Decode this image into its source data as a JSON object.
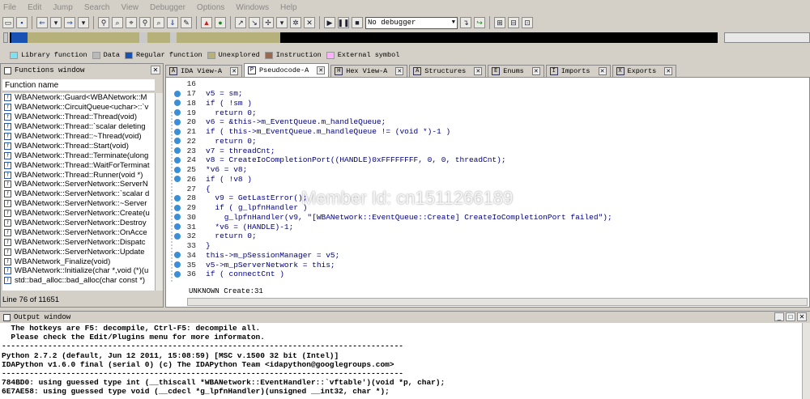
{
  "menu": [
    "File",
    "Edit",
    "Jump",
    "Search",
    "View",
    "Debugger",
    "Options",
    "Windows",
    "Help"
  ],
  "toolbar": {
    "debugger_select": "No debugger"
  },
  "legend": [
    {
      "label": "Library function",
      "color": "#7fe0ef"
    },
    {
      "label": "Data",
      "color": "#b9b9b9"
    },
    {
      "label": "Regular function",
      "color": "#1a52b4"
    },
    {
      "label": "Unexplored",
      "color": "#b6b07a"
    },
    {
      "label": "Instruction",
      "color": "#9a6a50"
    },
    {
      "label": "External symbol",
      "color": "#ffb0ff"
    }
  ],
  "functions_window": {
    "title": "Functions window",
    "column_header": "Function name",
    "status": "Line 76 of 11651",
    "items": [
      "WBANetwork::Guard<WBANetwork::M",
      "WBANetwork::CircuitQueue<uchar>::`v",
      "WBANetwork::Thread::Thread(void)",
      "WBANetwork::Thread::`scalar deleting",
      "WBANetwork::Thread::~Thread(void)",
      "WBANetwork::Thread::Start(void)",
      "WBANetwork::Thread::Terminate(ulong",
      "WBANetwork::Thread::WaitForTerminat",
      "WBANetwork::Thread::Runner(void *)",
      "WBANetwork::ServerNetwork::ServerN",
      "WBANetwork::ServerNetwork::`scalar d",
      "WBANetwork::ServerNetwork::~Server",
      "WBANetwork::ServerNetwork::Create(u",
      "WBANetwork::ServerNetwork::Destroy",
      "WBANetwork::ServerNetwork::OnAcce",
      "WBANetwork::ServerNetwork::Dispatc",
      "WBANetwork::ServerNetwork::Update",
      "WBANetwork_Finalize(void)",
      "WBANetwork::Initialize(char *,void (*)(u",
      "std::bad_alloc::bad_alloc(char const *)"
    ]
  },
  "tabs": [
    {
      "label": "IDA View-A",
      "icon": "A",
      "active": false
    },
    {
      "label": "Pseudocode-A",
      "icon": "P",
      "active": true
    },
    {
      "label": "Hex View-A",
      "icon": "H",
      "active": false
    },
    {
      "label": "Structures",
      "icon": "A",
      "active": false
    },
    {
      "label": "Enums",
      "icon": "E",
      "active": false
    },
    {
      "label": "Imports",
      "icon": "I",
      "active": false
    },
    {
      "label": "Exports",
      "icon": "X",
      "active": false
    }
  ],
  "code": {
    "lines": [
      {
        "n": "16",
        "dot": false,
        "text": ""
      },
      {
        "n": "17",
        "dot": true,
        "text": "v5 = sm;"
      },
      {
        "n": "18",
        "dot": true,
        "text": "if ( !sm )"
      },
      {
        "n": "19",
        "dot": true,
        "text": "  return 0;"
      },
      {
        "n": "20",
        "dot": true,
        "text": "v6 = &this->m_EventQueue.m_handleQueue;"
      },
      {
        "n": "21",
        "dot": true,
        "text": "if ( this->m_EventQueue.m_handleQueue != (void *)-1 )"
      },
      {
        "n": "22",
        "dot": true,
        "text": "  return 0;"
      },
      {
        "n": "23",
        "dot": true,
        "text": "v7 = threadCnt;"
      },
      {
        "n": "24",
        "dot": true,
        "text": "v8 = CreateIoCompletionPort((HANDLE)0xFFFFFFFF, 0, 0, threadCnt);"
      },
      {
        "n": "25",
        "dot": true,
        "text": "*v6 = v8;"
      },
      {
        "n": "26",
        "dot": true,
        "text": "if ( !v8 )"
      },
      {
        "n": "27",
        "dot": false,
        "text": "{"
      },
      {
        "n": "28",
        "dot": true,
        "text": "  v9 = GetLastError();"
      },
      {
        "n": "29",
        "dot": true,
        "text": "  if ( g_lpfnHandler )"
      },
      {
        "n": "30",
        "dot": true,
        "text": "    g_lpfnHandler(v9, \"[WBANetwork::EventQueue::Create] CreateIoCompletionPort failed\");"
      },
      {
        "n": "31",
        "dot": true,
        "text": "  *v6 = (HANDLE)-1;"
      },
      {
        "n": "32",
        "dot": true,
        "text": "  return 0;"
      },
      {
        "n": "33",
        "dot": false,
        "text": "}"
      },
      {
        "n": "34",
        "dot": true,
        "text": "this->m_pSessionManager = v5;"
      },
      {
        "n": "35",
        "dot": true,
        "text": "v5->m_pServerNetwork = this;"
      },
      {
        "n": "36",
        "dot": true,
        "text": "if ( connectCnt )"
      }
    ],
    "context_label": "UNKNOWN Create:31"
  },
  "output_window": {
    "title": "Output window",
    "lines": [
      "  The hotkeys are F5: decompile, Ctrl-F5: decompile all.",
      "  Please check the Edit/Plugins menu for more informaton.",
      "---------------------------------------------------------------------------------------",
      "Python 2.7.2 (default, Jun 12 2011, 15:08:59) [MSC v.1500 32 bit (Intel)]",
      "IDAPython v1.6.0 final (serial 0) (c) The IDAPython Team <idapython@googlegroups.com>",
      "---------------------------------------------------------------------------------------",
      "784BD0: using guessed type int (__thiscall *WBANetwork::EventHandler::`vftable')(void *p, char);",
      "6E7AE58: using guessed type void (__cdecl *g_lpfnHandler)(unsigned __int32, char *);"
    ]
  },
  "watermark": "Member Id: cn1511266189"
}
